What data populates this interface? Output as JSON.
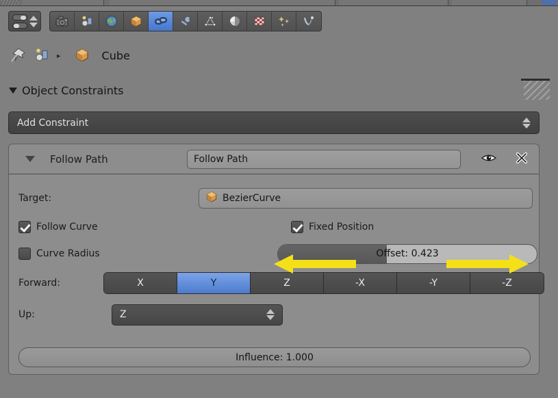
{
  "window": {
    "app": "Blender",
    "editor": "Properties"
  },
  "top_strip": {
    "visible": true
  },
  "properties_header": {
    "editor_type_selector": "editor-type-selector",
    "tabs": [
      {
        "name": "render-tab",
        "icon": "camera-icon",
        "active": false
      },
      {
        "name": "scene-tab",
        "icon": "scene-icon",
        "active": false
      },
      {
        "name": "world-tab",
        "icon": "globe-icon",
        "active": false
      },
      {
        "name": "object-tab",
        "icon": "cube-icon",
        "active": false
      },
      {
        "name": "constraints-tab",
        "icon": "chain-link-icon",
        "active": true
      },
      {
        "name": "modifiers-tab",
        "icon": "wrench-icon",
        "active": false
      },
      {
        "name": "data-tab",
        "icon": "mesh-data-icon",
        "active": false
      },
      {
        "name": "material-tab",
        "icon": "material-ball-icon",
        "active": false
      },
      {
        "name": "texture-tab",
        "icon": "checker-icon",
        "active": false
      },
      {
        "name": "particles-tab",
        "icon": "sparkles-icon",
        "active": false
      },
      {
        "name": "physics-tab",
        "icon": "physics-icon",
        "active": false
      }
    ]
  },
  "breadcrumb": {
    "pin_icon": "pin-icon",
    "scene_icon": "scene-icon",
    "separator": "▸",
    "object_icon": "cube-icon",
    "object_name": "Cube"
  },
  "panel": {
    "collapse_icon": "triangle-down-icon",
    "title": "Object Constraints",
    "grip_icon": "resize-grip-icon"
  },
  "add_constraint": {
    "label": "Add Constraint",
    "dropdown_icon": "updown-arrows-icon"
  },
  "constraint": {
    "collapse_icon": "triangle-down-icon",
    "type_label": "Follow Path",
    "name_value": "Follow Path",
    "visibility_icon": "eye-icon",
    "delete_icon": "close-x-icon",
    "target": {
      "label": "Target:",
      "icon": "object-data-icon",
      "value": "BezierCurve"
    },
    "follow_curve": {
      "label": "Follow Curve",
      "checked": true
    },
    "fixed_position": {
      "label": "Fixed Position",
      "checked": true
    },
    "curve_radius": {
      "label": "Curve Radius",
      "checked": false
    },
    "offset": {
      "label": "Offset: 0.423",
      "value": 0.423,
      "fill_percent": 42
    },
    "forward": {
      "label": "Forward:",
      "options": [
        "X",
        "Y",
        "Z",
        "-X",
        "-Y",
        "-Z"
      ],
      "selected": "Y"
    },
    "up": {
      "label": "Up:",
      "value": "Z",
      "dropdown_icon": "updown-arrows-icon"
    },
    "influence": {
      "label": "Influence: 1.000",
      "value": 1.0
    }
  },
  "annotations": {
    "left_arrow": "yellow-left-arrow",
    "right_arrow": "yellow-right-arrow",
    "color": "#F5E017"
  },
  "colors": {
    "background": "#808080",
    "panel": "#8D8D8D",
    "accent_blue": "#5A88D0",
    "widget_dark": "#4D4D4D",
    "annotation_yellow": "#F5E017"
  }
}
